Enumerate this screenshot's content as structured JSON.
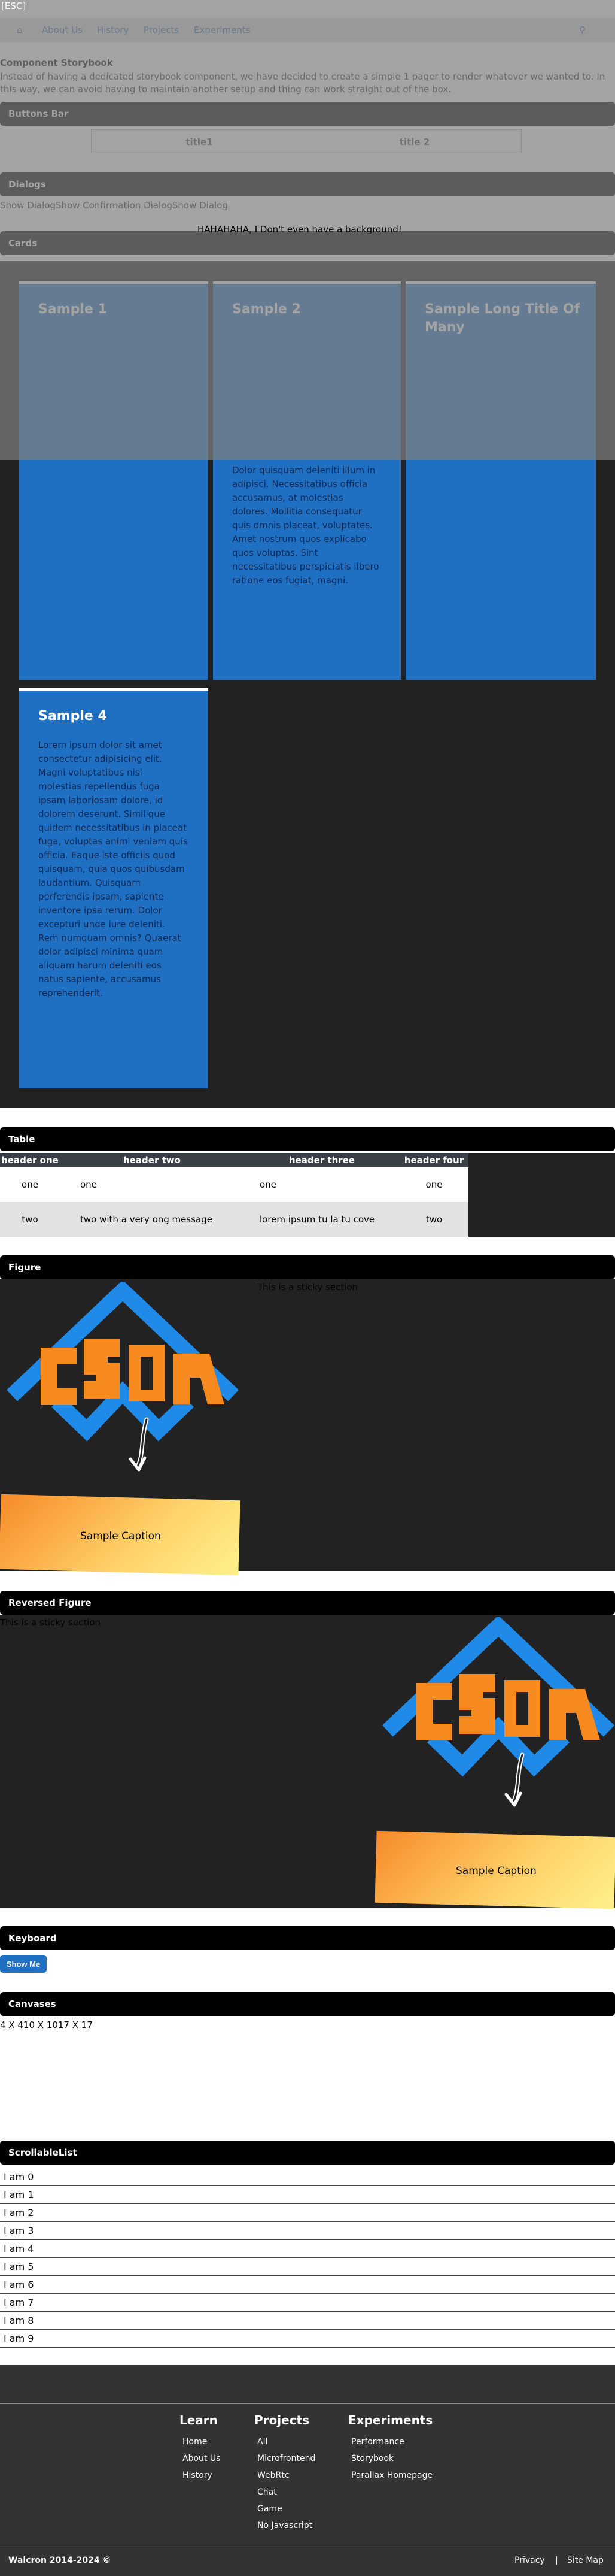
{
  "esc_label": "[ESC]",
  "nav": {
    "home_icon": "home-icon",
    "about": "About Us",
    "history": "History",
    "projects": "Projects",
    "experiments": "Experiments",
    "search_icon": "search-icon"
  },
  "intro": {
    "title": "Component Storybook",
    "text": "Instead of having a dedicated storybook component, we have decided to create a simple 1 pager to render whatever we wanted to. In this way, we can avoid having to maintain another setup and thing can work straight out of the box."
  },
  "sections": {
    "buttons_bar": "Buttons Bar",
    "dialogs": "Dialogs",
    "cards": "Cards",
    "table": "Table",
    "figure": "Figure",
    "reversed_figure": "Reversed Figure",
    "keyboard": "Keyboard",
    "canvases": "Canvases",
    "scrollable_list": "ScrollableList"
  },
  "buttons": [
    "title1",
    "title 2"
  ],
  "dialogs": [
    "Show Dialog",
    "Show Confirmation Dialog",
    "Show Dialog"
  ],
  "dialog_message": "HAHAHAHA, I Don't even have a background!",
  "cards": [
    {
      "title": "Sample 1",
      "body": ""
    },
    {
      "title": "Sample 2",
      "body": "Dolor quisquam deleniti illum in adipisci. Necessitatibus officia accusamus, at molestias dolores. Mollitia consequatur quis omnis placeat, voluptates. Amet nostrum quos explicabo quos voluptas. Sint necessitatibus perspiciatis libero ratione eos fugiat, magni."
    },
    {
      "title": "Sample Long Title Of Many",
      "body": ""
    },
    {
      "title": "Sample 4",
      "body": "Lorem ipsum dolor sit amet consectetur adipisicing elit. Magni voluptatibus nisi molestias repellendus fuga ipsam laboriosam dolore, id dolorem deserunt. Similique quidem necessitatibus in placeat fuga, voluptas animi veniam quis officia. Eaque iste officiis quod quisquam, quia quos quibusdam laudantium. Quisquam perferendis ipsam, sapiente inventore ipsa rerum. Dolor excepturi unde iure deleniti. Rem numquam omnis? Quaerat dolor adipisci minima quam aliquam harum deleniti eos natus sapiente, accusamus reprehenderit."
    }
  ],
  "table": {
    "headers": [
      "header one",
      "header two",
      "header three",
      "header four"
    ],
    "rows": [
      [
        "one",
        "one",
        "one",
        "one"
      ],
      [
        "two",
        "two with a very ong message",
        "lorem ipsum tu la tu cove",
        "two"
      ]
    ]
  },
  "figure": {
    "sticky_text": "This is a sticky section",
    "caption": "Sample Caption"
  },
  "reversed_figure": {
    "sticky_text": "This is a sticky section",
    "caption": "Sample Caption"
  },
  "keyboard": {
    "button": "Show Me"
  },
  "canvases": {
    "info": "4 X 410 X 1017 X 17"
  },
  "scrollable_list": [
    "I am 0",
    "I am 1",
    "I am 2",
    "I am 3",
    "I am 4",
    "I am 5",
    "I am 6",
    "I am 7",
    "I am 8",
    "I am 9"
  ],
  "footer": {
    "learn_title": "Learn",
    "learn_links": [
      "Home",
      "About Us",
      "History"
    ],
    "projects_title": "Projects",
    "projects_links": [
      "All",
      "Microfrontend",
      "WebRtc",
      "Chat",
      "Game",
      "No Javascript"
    ],
    "experiments_title": "Experiments",
    "experiments_links": [
      "Performance",
      "Storybook",
      "Parallax Homepage"
    ],
    "copyright": "Walcron 2014-2024 ©",
    "privacy": "Privacy",
    "separator": "|",
    "sitemap": "Site Map"
  },
  "colors": {
    "card_blue": "#1f6fc3",
    "logo_blue": "#1f8ae8",
    "logo_orange": "#f78a1e",
    "dark_bg": "#222222"
  }
}
